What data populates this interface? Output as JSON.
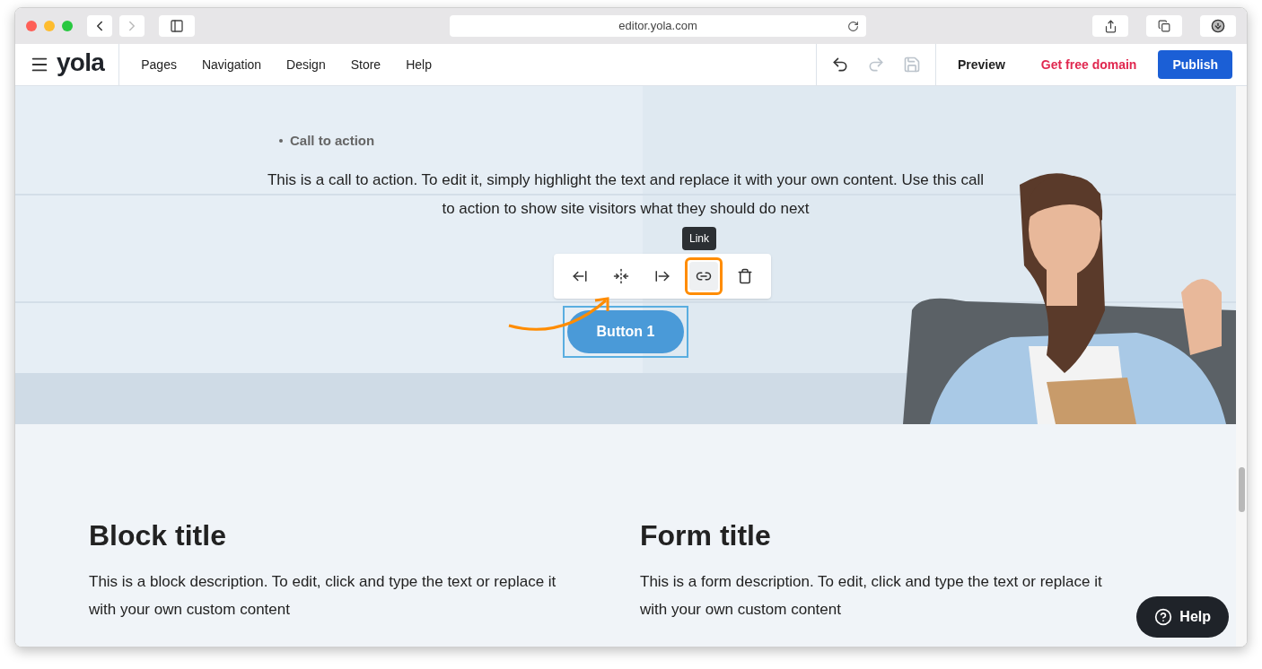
{
  "browser": {
    "url": "editor.yola.com"
  },
  "header": {
    "logo": "yola",
    "nav": [
      {
        "label": "Pages"
      },
      {
        "label": "Navigation"
      },
      {
        "label": "Design"
      },
      {
        "label": "Store"
      },
      {
        "label": "Help"
      }
    ],
    "history": {
      "undo_enabled": true,
      "redo_enabled": false,
      "save_enabled": false
    },
    "preview": "Preview",
    "domain": "Get free domain",
    "publish": "Publish"
  },
  "hero": {
    "bullet": "Call to action",
    "text": "This is a call to action. To edit it, simply highlight the text and replace it with your own content. Use this call to action to show site visitors what they should do next",
    "tooltip": "Link",
    "toolbar": [
      {
        "kind": "align-left",
        "selected": false
      },
      {
        "kind": "align-center",
        "selected": false
      },
      {
        "kind": "align-right",
        "selected": false
      },
      {
        "kind": "link",
        "selected": true
      },
      {
        "kind": "delete",
        "selected": false
      }
    ],
    "button": "Button 1"
  },
  "blocks": [
    {
      "title": "Block title",
      "description": "This is a block description. To edit, click and type the text or replace it with your own custom content"
    },
    {
      "title": "Form title",
      "description": "This is a form description. To edit, click and type the text or replace it with your own custom content"
    }
  ],
  "help": "Help"
}
